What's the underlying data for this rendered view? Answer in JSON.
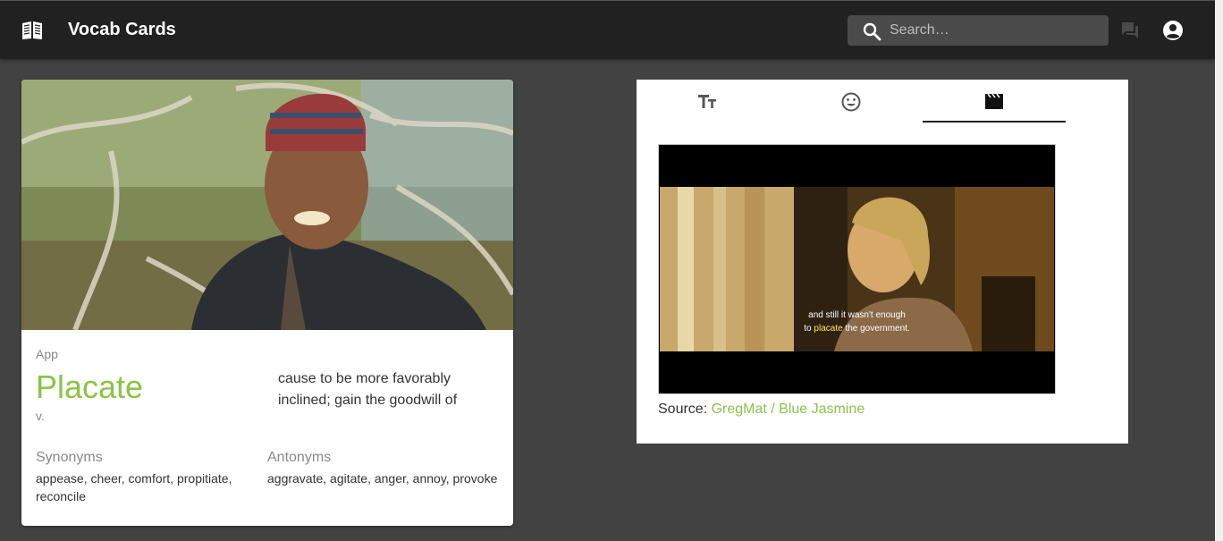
{
  "header": {
    "app_title": "Vocab Cards",
    "search_placeholder": "Search…",
    "app_icon": "book-open-icon",
    "chat_icon": "chat-icon",
    "account_icon": "account-circle-icon"
  },
  "word_card": {
    "category": "App",
    "word": "Placate",
    "part_of_speech": "v.",
    "definition": "cause to be more favorably inclined; gain the goodwill of",
    "synonyms_title": "Synonyms",
    "synonyms": "appease, cheer, comfort, propitiate, reconcile",
    "antonyms_title": "Antonyms",
    "antonyms": "aggravate, agitate, anger, annoy, provoke",
    "accent_color": "#8bc34a"
  },
  "media_card": {
    "tabs": [
      {
        "icon": "text-size-icon",
        "selected": false
      },
      {
        "icon": "emoji-icon",
        "selected": false
      },
      {
        "icon": "movie-clapper-icon",
        "selected": true
      }
    ],
    "subtitle_line1": "and still it wasn't enough",
    "subtitle_line2_before": "to",
    "subtitle_highlight": "placate",
    "subtitle_line2_after": "the government.",
    "source_label": "Source:",
    "source_link": "GregMat / Blue Jasmine"
  }
}
